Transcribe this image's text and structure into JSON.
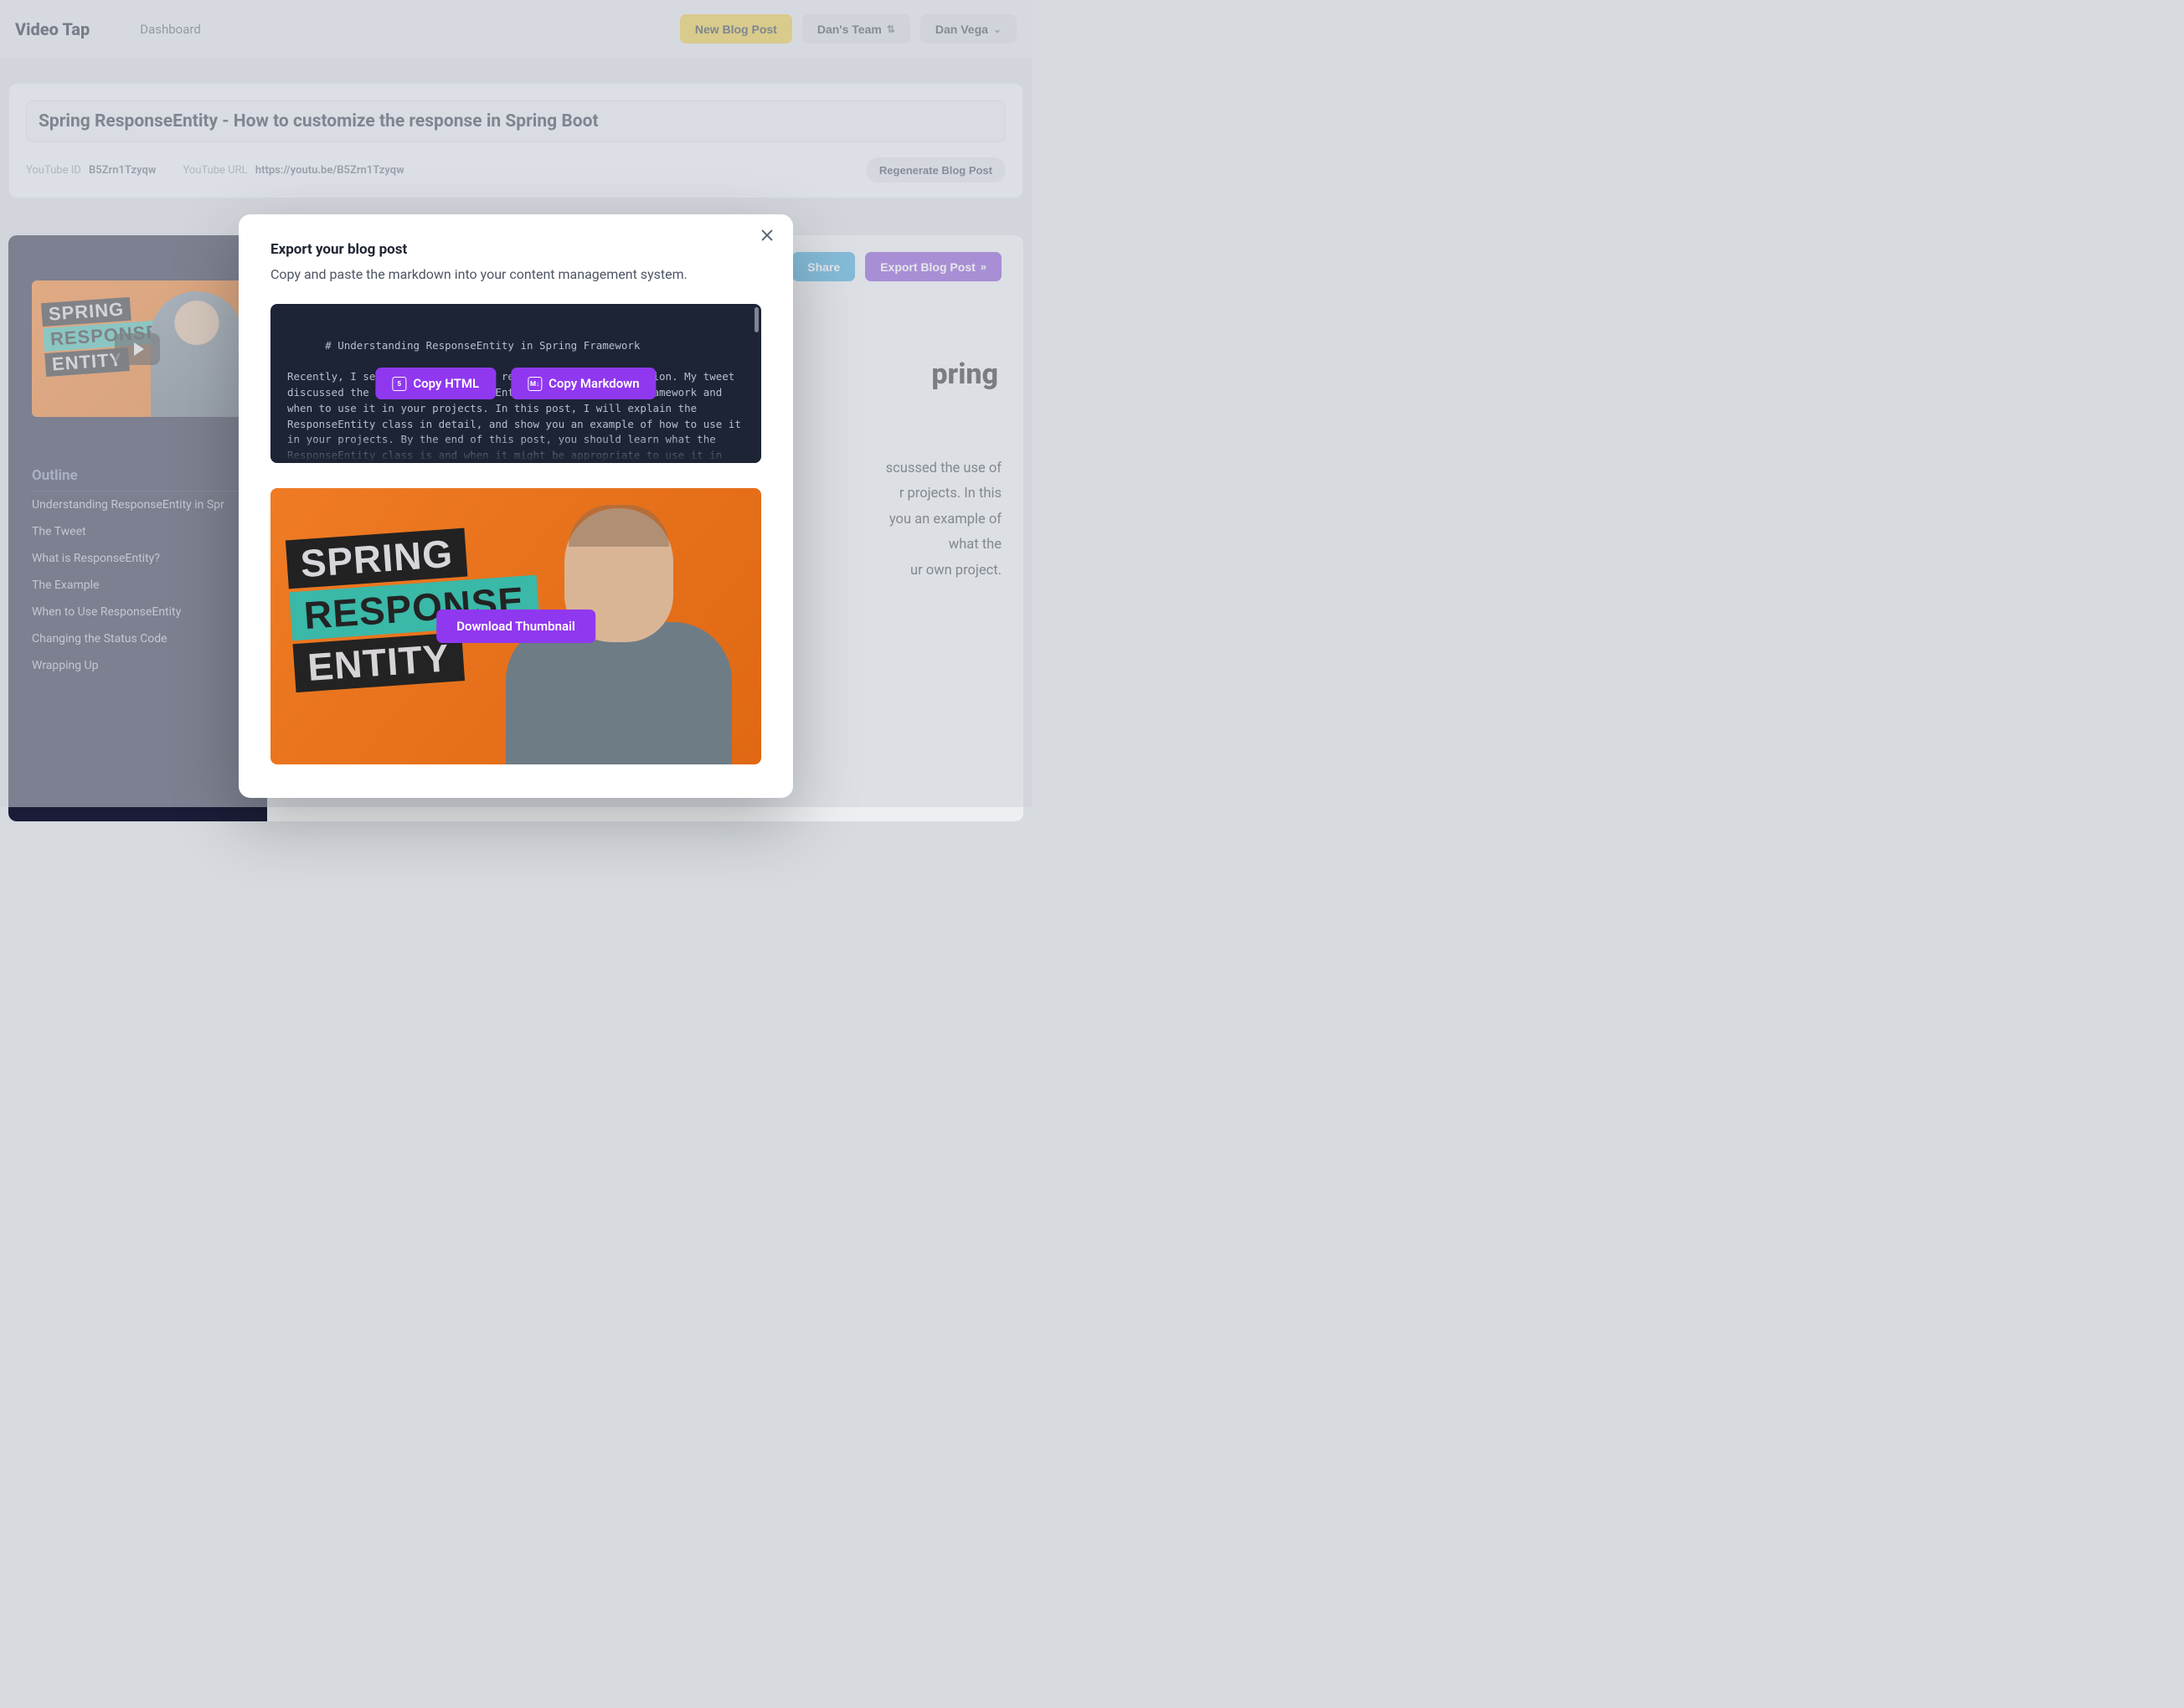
{
  "header": {
    "brand": "Video Tap",
    "nav_dashboard": "Dashboard",
    "new_blog_post": "New Blog Post",
    "team_label": "Dan's Team",
    "user_label": "Dan Vega"
  },
  "card": {
    "title": "Spring ResponseEntity -  How to customize the response in Spring Boot",
    "youtube_id_label": "YouTube ID",
    "youtube_id": "B5Zrn1Tzyqw",
    "youtube_url_label": "YouTube URL",
    "youtube_url": "https://youtu.be/B5Zrn1Tzyqw",
    "regenerate": "Regenerate Blog Post"
  },
  "sidebar": {
    "thumb_words": {
      "w1": "SPRING",
      "w2": "RESPONSE",
      "w3": "ENTITY"
    },
    "outline_title": "Outline",
    "items": [
      "Understanding ResponseEntity in Spr",
      "The Tweet",
      "What is ResponseEntity?",
      "The Example",
      "When to Use ResponseEntity",
      "Changing the Status Code",
      "Wrapping Up"
    ]
  },
  "editor": {
    "share": "Share",
    "export": "Export Blog Post",
    "article_h1_visible": "pring",
    "article_p_visible": "scussed the use of\nr projects. In this\nyou an example of\nwhat the\nur own project."
  },
  "modal": {
    "title": "Export your blog post",
    "subtitle": "Copy and paste the markdown into your content management system.",
    "copy_html": "Copy HTML",
    "copy_markdown": "Copy Markdown",
    "download_thumbnail": "Download Thumbnail",
    "markdown": "# Understanding ResponseEntity in Spring Framework\n\nRecently, I sent out a tweet that received a lot of attention. My tweet discussed the use of the ResponseEntity class in Spring Framework and when to use it in your projects. In this post, I will explain the ResponseEntity class in detail, and show you an example of how to use it in your projects. By the end of this post, you should learn what the ResponseEntity class is and when it might be appropriate to use it in your own project.\n\n## The Tweet"
  }
}
